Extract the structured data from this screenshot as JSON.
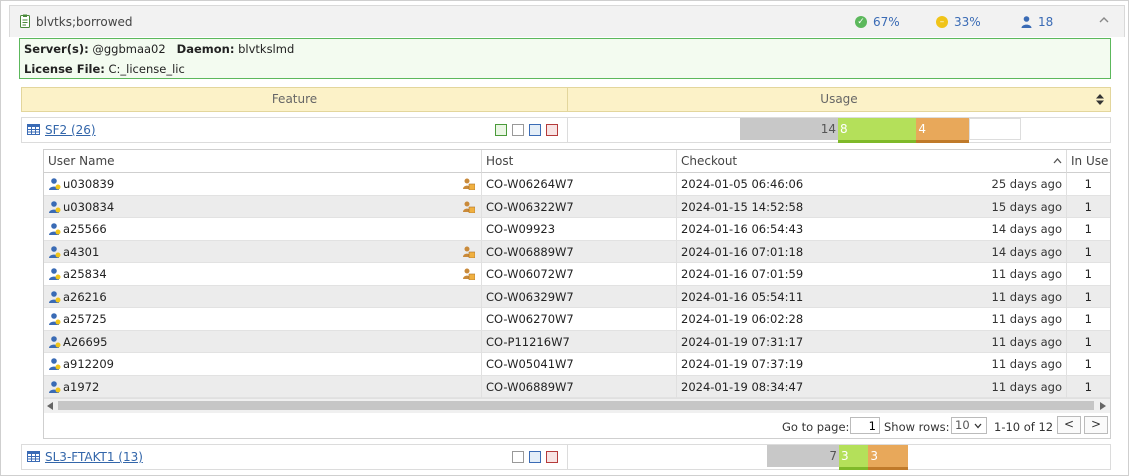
{
  "panel": {
    "title": "blvtks;borrowed",
    "stats": [
      {
        "value": "67%",
        "color": "#5cb85c",
        "icon": "check-circle-icon"
      },
      {
        "value": "33%",
        "color": "#f0c419",
        "icon": "minus-circle-icon"
      },
      {
        "value": "18",
        "color": "#3a6bb5",
        "icon": "user-icon"
      }
    ]
  },
  "info": {
    "servers_label": "Server(s):",
    "servers_value": "@ggbmaa02",
    "daemon_label": "Daemon:",
    "daemon_value": "blvtkslmd",
    "license_label": "License File:",
    "license_value": "C:_license_lic"
  },
  "feature_header": {
    "feature": "Feature",
    "usage": "Usage"
  },
  "features": [
    {
      "name": "SF2 (26)",
      "usage": {
        "total": 26,
        "total_label": "14",
        "green_value": 8,
        "green_label": "8",
        "orange_value": 4,
        "orange_label": "4"
      }
    },
    {
      "name": "SL3-FTAKT1 (13)",
      "usage": {
        "total": 13,
        "total_label": "7",
        "green_value": 3,
        "green_label": "3",
        "orange_value": 3,
        "orange_label": "3"
      }
    }
  ],
  "user_table": {
    "columns": [
      "User Name",
      "Host",
      "Checkout",
      "In Use"
    ],
    "rows": [
      {
        "user": "u030839",
        "host": "CO-W06264W7",
        "checkout": "2024-01-05 06:46:06",
        "ago": "25 days ago",
        "in_use": "1",
        "borrowed": true
      },
      {
        "user": "u030834",
        "host": "CO-W06322W7",
        "checkout": "2024-01-15 14:52:58",
        "ago": "15 days ago",
        "in_use": "1",
        "borrowed": true
      },
      {
        "user": "a25566",
        "host": "CO-W09923",
        "checkout": "2024-01-16 06:54:43",
        "ago": "14 days ago",
        "in_use": "1",
        "borrowed": false
      },
      {
        "user": "a4301",
        "host": "CO-W06889W7",
        "checkout": "2024-01-16 07:01:18",
        "ago": "14 days ago",
        "in_use": "1",
        "borrowed": true
      },
      {
        "user": "a25834",
        "host": "CO-W06072W7",
        "checkout": "2024-01-16 07:01:59",
        "ago": "11 days ago",
        "in_use": "1",
        "borrowed": true
      },
      {
        "user": "a26216",
        "host": "CO-W06329W7",
        "checkout": "2024-01-16 05:54:11",
        "ago": "11 days ago",
        "in_use": "1",
        "borrowed": false
      },
      {
        "user": "a25725",
        "host": "CO-W06270W7",
        "checkout": "2024-01-19 06:02:28",
        "ago": "11 days ago",
        "in_use": "1",
        "borrowed": false
      },
      {
        "user": "A26695",
        "host": "CO-P11216W7",
        "checkout": "2024-01-19 07:31:17",
        "ago": "11 days ago",
        "in_use": "1",
        "borrowed": false
      },
      {
        "user": "a912209",
        "host": "CO-W05041W7",
        "checkout": "2024-01-19 07:37:19",
        "ago": "11 days ago",
        "in_use": "1",
        "borrowed": false
      },
      {
        "user": "a1972",
        "host": "CO-W06889W7",
        "checkout": "2024-01-19 08:34:47",
        "ago": "11 days ago",
        "in_use": "1",
        "borrowed": false
      }
    ]
  },
  "pager": {
    "goto_label": "Go to page:",
    "page_value": "1",
    "rows_label": "Show rows:",
    "rows_value": "10",
    "range": "1-10 of 12",
    "prev": "<",
    "next": ">"
  },
  "colors": {
    "accent": "#3a6bb5",
    "green": "#b4e05a",
    "orange": "#e8a85a",
    "total": "#c8c8c8"
  }
}
